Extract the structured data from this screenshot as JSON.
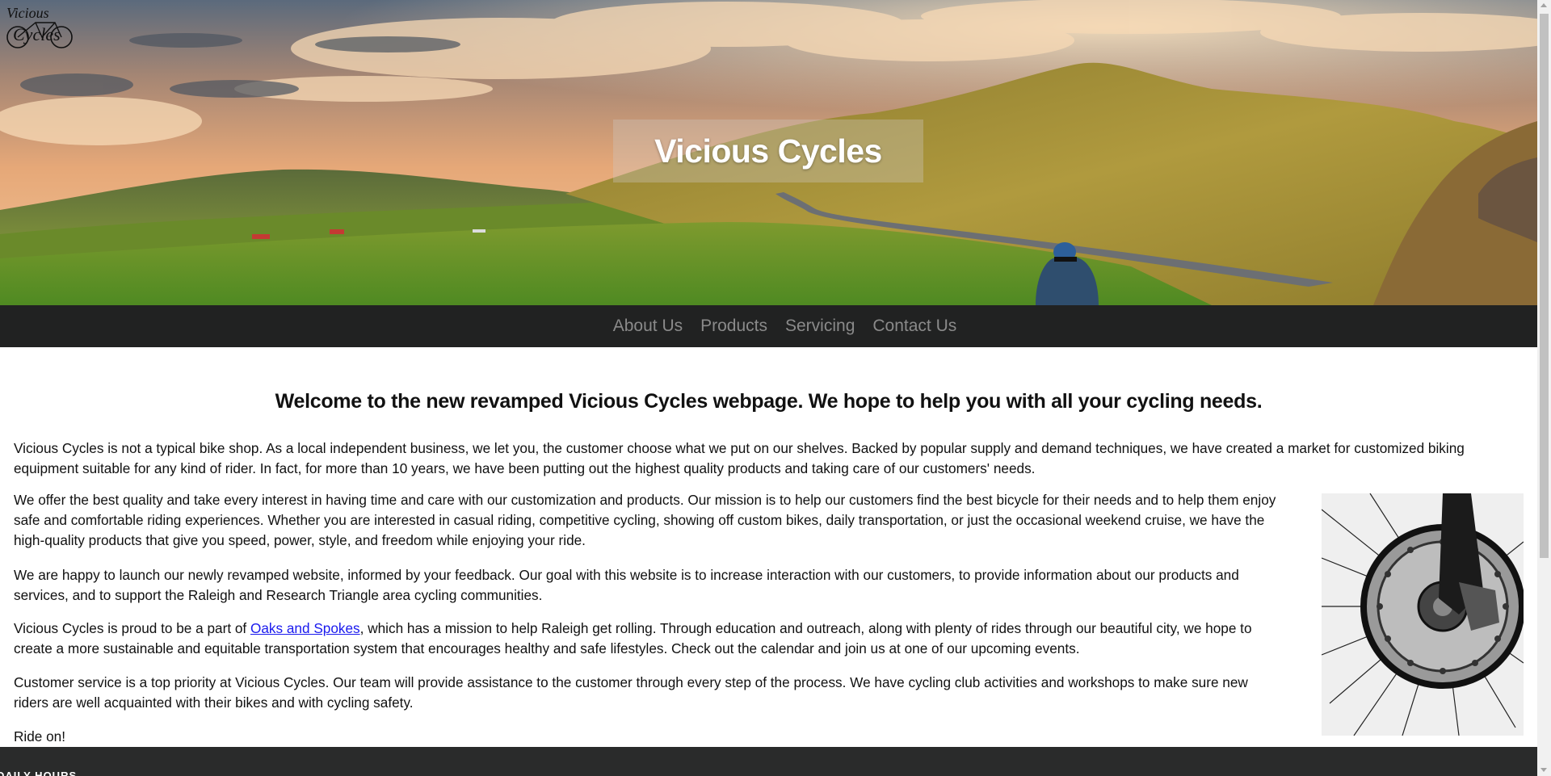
{
  "logo": {
    "line1": "Vicious",
    "line2": "Cycles"
  },
  "hero": {
    "title": "Vicious Cycles"
  },
  "nav": {
    "items": [
      {
        "label": "About Us"
      },
      {
        "label": "Products"
      },
      {
        "label": "Servicing"
      },
      {
        "label": "Contact Us"
      }
    ]
  },
  "main": {
    "welcome": "Welcome to the new revamped Vicious Cycles webpage. We hope to help you with all your cycling needs.",
    "p1": "Vicious Cycles is not a typical bike shop. As a local independent business, we let you, the customer choose what we put on our shelves. Backed by popular supply and demand techniques, we have created a market for customized biking equipment suitable for any kind of rider. In fact, for more than 10 years, we have been putting out the highest quality products and taking care of our customers' needs.",
    "p2": "We offer the best quality and take every interest in having time and care with our customization and products. Our mission is to help our customers find the best bicycle for their needs and to help them enjoy safe and comfortable riding experiences. Whether you are interested in casual riding, competitive cycling, showing off custom bikes, daily transportation, or just the occasional weekend cruise, we have the high-quality products that give you speed, power, style, and freedom while enjoying your ride.",
    "p3": "We are happy to launch our newly revamped website, informed by your feedback. Our goal with this website is to increase interaction with our customers, to provide information about our products and services, and to support the Raleigh and Research Triangle area cycling communities.",
    "p4_before": "Vicious Cycles is proud to be a part of ",
    "p4_link": "Oaks and Spokes",
    "p4_after": ", which has a mission to help Raleigh get rolling. Through education and outreach, along with plenty of rides through our beautiful city, we hope to create a more sustainable and equitable transportation system that encourages healthy and safe lifestyles. Check out the calendar and join us at one of our upcoming events.",
    "p5": "Customer service is a top priority at Vicious Cycles. Our team will provide assistance to the customer through every step of the process. We have cycling club activities and workshops to make sure new riders are well acquainted with their bikes and with cycling safety.",
    "p6": "Ride on!"
  },
  "footer": {
    "text": "DAILY HOURS"
  },
  "colors": {
    "nav_bg": "#212222",
    "nav_text": "#8a8a8a",
    "link": "#1a1aee",
    "footer_bg": "#2a2b2b"
  }
}
